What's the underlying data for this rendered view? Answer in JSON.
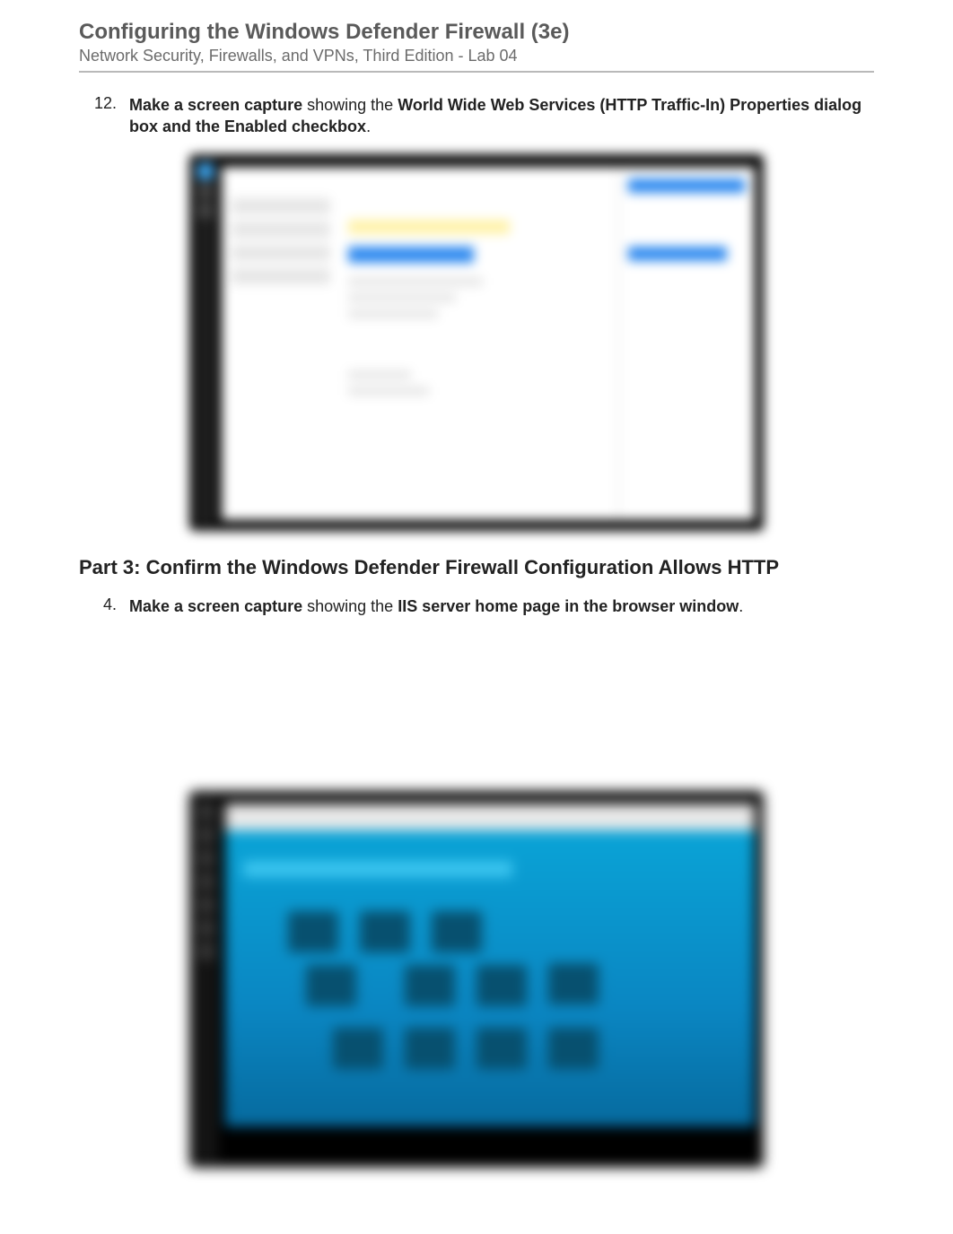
{
  "header": {
    "title": "Configuring the Windows Defender Firewall (3e)",
    "subtitle": "Network Security, Firewalls, and VPNs, Third Edition - Lab 04"
  },
  "items": {
    "twelve": {
      "number": "12.",
      "lead_bold": "Make a screen capture",
      "mid": " showing the ",
      "tail_bold": "World Wide Web Services (HTTP Traffic-In) Properties dialog box and the Enabled checkbox",
      "end": "."
    },
    "four": {
      "number": "4.",
      "lead_bold": "Make a screen capture",
      "mid": " showing the ",
      "tail_bold": "IIS server home page in the browser window",
      "end": "."
    }
  },
  "section_heading": "Part 3: Confirm the Windows Defender Firewall Configuration Allows HTTP"
}
